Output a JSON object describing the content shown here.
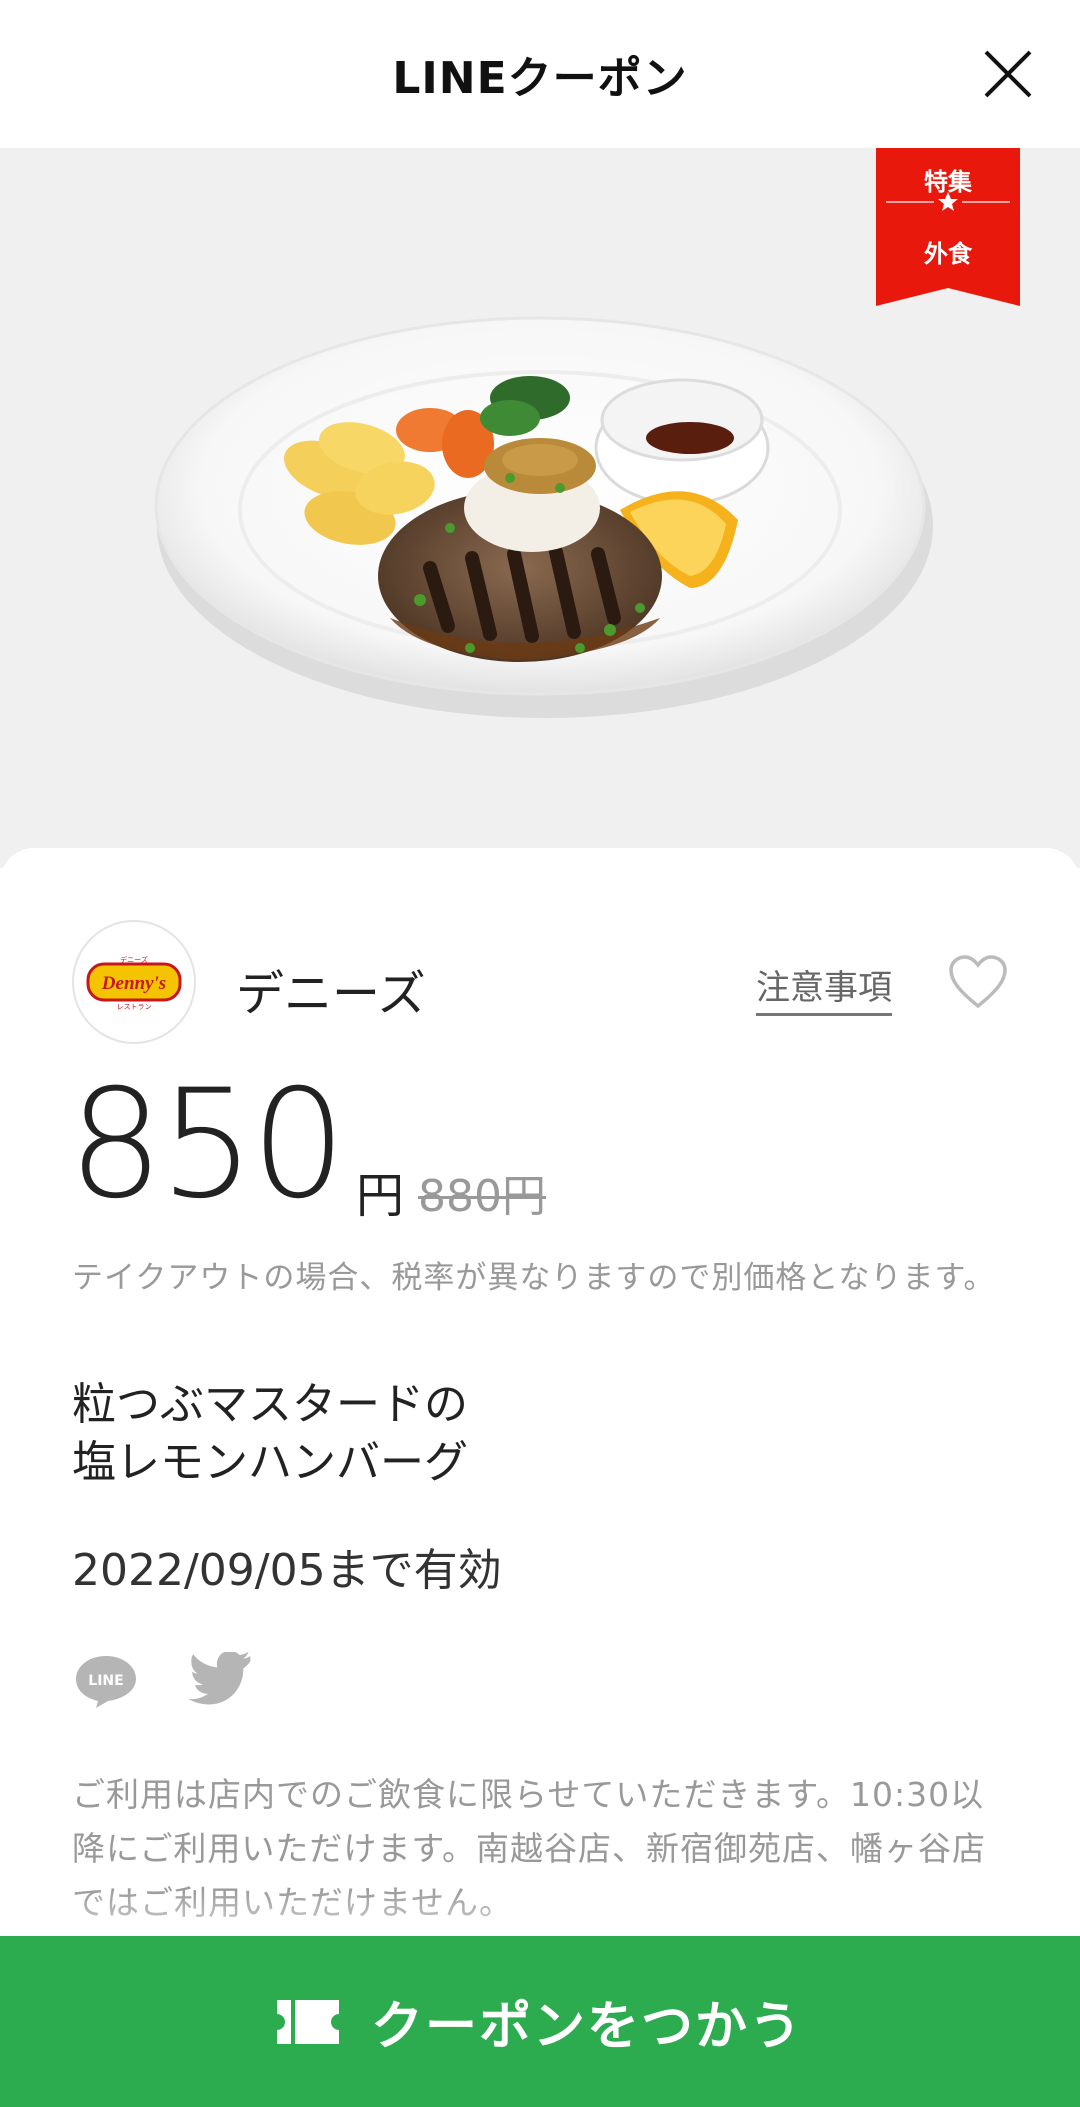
{
  "header": {
    "title": "LINEクーポン",
    "close_icon": "close-icon"
  },
  "badge": {
    "top": "特集",
    "bottom": "外食",
    "color": "#e8180d"
  },
  "brand": {
    "name": "デニーズ",
    "logo_text": "Denny's",
    "logo_small_top": "デニーズ",
    "logo_small_bottom": "レストラン"
  },
  "links": {
    "notes": "注意事項"
  },
  "price": {
    "amount": "850",
    "unit": "円",
    "original": "880円"
  },
  "tax_note": "テイクアウトの場合、税率が異なりますので別価格となります。",
  "product": {
    "name": "粒つぶマスタードの\n塩レモンハンバーグ"
  },
  "validity": "2022/09/05まで有効",
  "share": {
    "line_label": "LINE",
    "line_icon": "line-share-icon",
    "twitter_icon": "twitter-icon"
  },
  "terms": "ご利用は店内でのご飲食に限らせていただきます。10:30以降にご利用いただけます。南越谷店、新宿御苑店、幡ヶ谷店ではご利用いただけません。",
  "cta": {
    "label": "クーポンをつかう",
    "icon": "ticket-icon",
    "color": "#2dab4f"
  }
}
